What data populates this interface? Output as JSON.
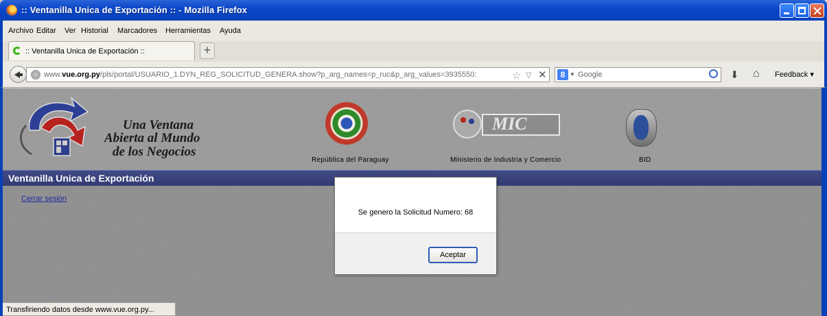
{
  "window": {
    "title": ":: Ventanilla Unica de Exportación :: - Mozilla Firefox"
  },
  "menu": {
    "items": [
      "Archivo",
      "Editar",
      "Ver",
      "Historial",
      "Marcadores",
      "Herramientas",
      "Ayuda"
    ]
  },
  "tab": {
    "title": ":: Ventanilla Unica de Exportación ::"
  },
  "navbar": {
    "url_prefix": "www.",
    "url_domain": "vue.org.py",
    "url_path": "/pls/portal/USUARIO_1.DYN_REG_SOLICITUD_GENERA.show?p_arg_names=p_ruc&p_arg_values=3935550:",
    "search_engine": "Google",
    "feedback_label": "Feedback"
  },
  "page": {
    "slogan_line1": "Una Ventana",
    "slogan_line2": "Abierta al Mundo",
    "slogan_line3": "de los Negocios",
    "seal_label": "República del Paraguay",
    "mic_text": "MIC",
    "mic_label": "Ministerio de Industria y Comercio",
    "bid_label": "BID",
    "banner_title": "Ventanilla Unica de Exportación",
    "logout_link": "Cerrar sesión"
  },
  "dialog": {
    "message": "Se genero la Solicitud Numero: 68",
    "ok_label": "Aceptar"
  },
  "statusbar": {
    "text": "Transfiriendo datos desde www.vue.org.py..."
  },
  "colors": {
    "titlebar": "#0840b8",
    "banner": "#3a4378",
    "content_bg": "#8f8f8f"
  }
}
